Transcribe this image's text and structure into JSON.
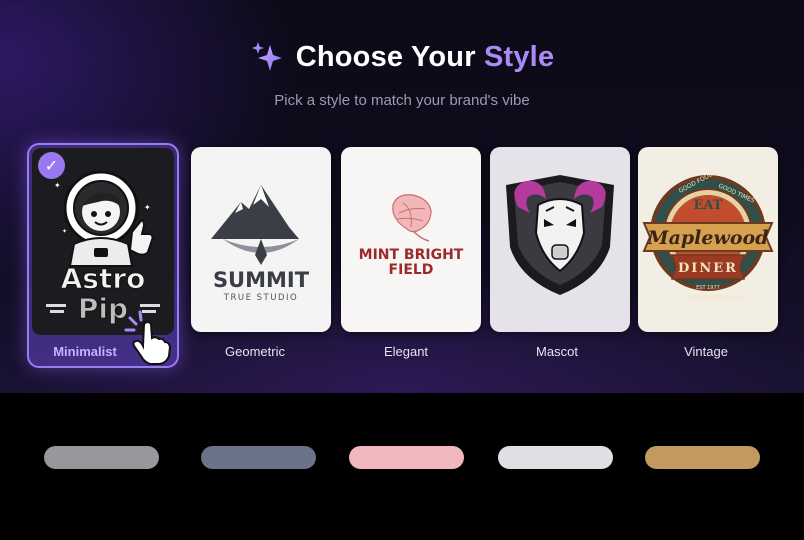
{
  "header": {
    "title_main": "Choose Your",
    "title_accent": "Style",
    "subtitle": "Pick a style to match your brand's vibe"
  },
  "styles": [
    {
      "label": "Minimalist",
      "selected": true,
      "logo_text": [
        "Astro",
        "Pip"
      ]
    },
    {
      "label": "Geometric",
      "selected": false,
      "logo_text": [
        "SUMMIT",
        "TRUE STUDIO"
      ]
    },
    {
      "label": "Elegant",
      "selected": false,
      "logo_text": [
        "MINT BRIGHT",
        "FIELD"
      ]
    },
    {
      "label": "Mascot",
      "selected": false,
      "logo_text": []
    },
    {
      "label": "Vintage",
      "selected": false,
      "logo_text": [
        "EAT",
        "Maplewood",
        "DINER",
        "GOOD FOOD",
        "GOOD TIMES",
        "EST 1977",
        "BREAKFAST",
        "LUNCH",
        "DINNER"
      ]
    }
  ],
  "swatches": [
    {
      "name": "minimalist",
      "color": "#98989c"
    },
    {
      "name": "geometric",
      "color": "#6b7388"
    },
    {
      "name": "elegant",
      "color": "#f0b8bd"
    },
    {
      "name": "mascot",
      "color": "#e2dee6"
    },
    {
      "name": "vintage",
      "color": "#c29a60"
    }
  ],
  "colors": {
    "accent": "#a98af7",
    "selected_border": "#9b7bf2",
    "background": "#0f0c1e"
  },
  "icons": {
    "title": "sparkle-icon",
    "selected": "check-icon",
    "pointer": "hand-pointer-icon"
  }
}
